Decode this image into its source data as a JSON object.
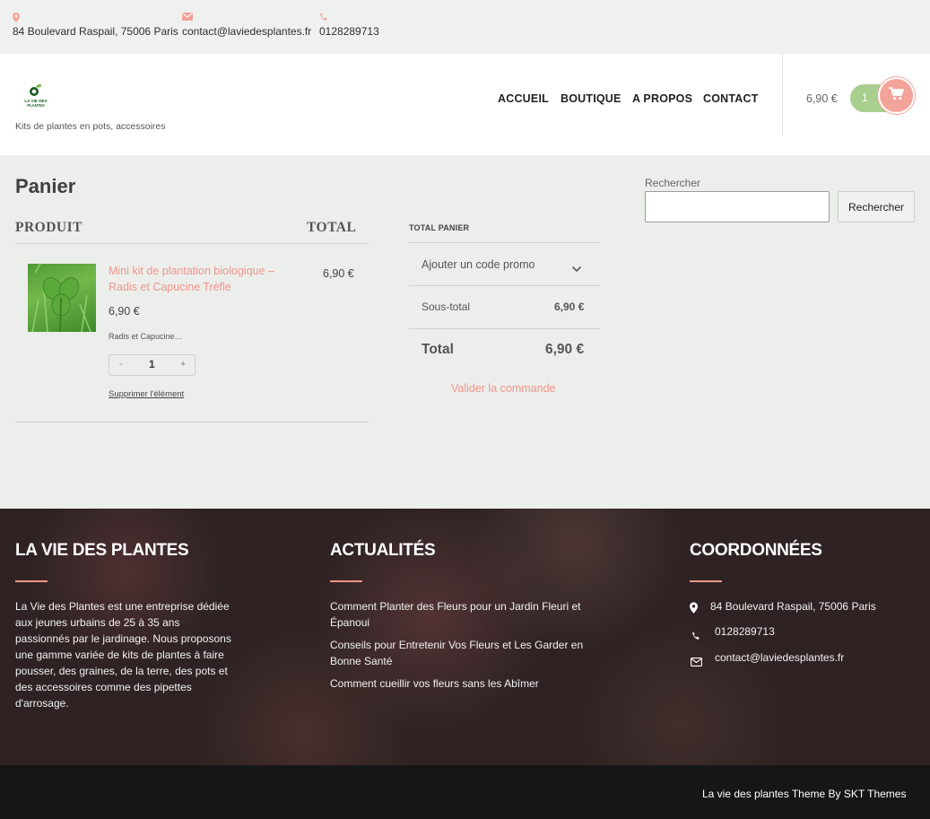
{
  "topbar": {
    "address": "84 Boulevard Raspail, 75006 Paris",
    "email": "contact@laviedesplantes.fr",
    "phone": "0128289713",
    "icon_color": "#f3a49a"
  },
  "header": {
    "logo_text": "LA VIE DES PLANTES",
    "tagline": "Kits de plantes en pots, accessoires",
    "nav": [
      "ACCUEIL",
      "BOUTIQUE",
      "A PROPOS",
      "CONTACT"
    ],
    "cart_total": "6,90 €",
    "cart_count": "1",
    "cart_icon": "shopping-cart-icon"
  },
  "cart": {
    "title": "Panier",
    "headers": {
      "product": "PRODUIT",
      "total": "TOTAL"
    },
    "items": [
      {
        "name": "Mini kit de plantation biologique – Radis et Capucine Trèfle",
        "price": "6,90 €",
        "meta": "Radis et Capucine…",
        "quantity": "1",
        "minus": "-",
        "plus": "+",
        "remove": "Supprimer l'élément",
        "line_total": "6,90 €"
      }
    ]
  },
  "totals": {
    "title": "TOTAL PANIER",
    "promo": "Ajouter un code promo",
    "subtotal_label": "Sous-total",
    "subtotal_value": "6,90 €",
    "total_label": "Total",
    "total_value": "6,90 €",
    "checkout": "Valider la commande"
  },
  "search": {
    "label": "Rechercher",
    "button": "Rechercher",
    "value": ""
  },
  "footer": {
    "about": {
      "title": "LA VIE DES PLANTES",
      "text": "La Vie des Plantes est une entreprise dédiée aux jeunes urbains de 25 à 35 ans passionnés par le jardinage. Nous proposons une gamme variée de kits de plantes à faire pousser, des graines, de la terre, des pots et des accessoires comme des pipettes d'arrosage."
    },
    "news": {
      "title": "ACTUALITÉS",
      "items": [
        "Comment Planter des Fleurs pour un Jardin Fleuri et Épanoui",
        "Conseils pour Entretenir Vos Fleurs et Les Garder en Bonne Santé",
        "Comment cueillir vos fleurs sans les Abîmer"
      ]
    },
    "contact": {
      "title": "COORDONNÉES",
      "address": "84 Boulevard Raspail, 75006 Paris",
      "phone": "0128289713",
      "email": "contact@laviedesplantes.fr"
    },
    "credit": "La vie des plantes Theme By SKT Themes"
  },
  "colors": {
    "accent": "#f0958a",
    "cart_green": "#a9cf8e",
    "footer_bg": "#2e2322",
    "bottom_bg": "#161616"
  }
}
